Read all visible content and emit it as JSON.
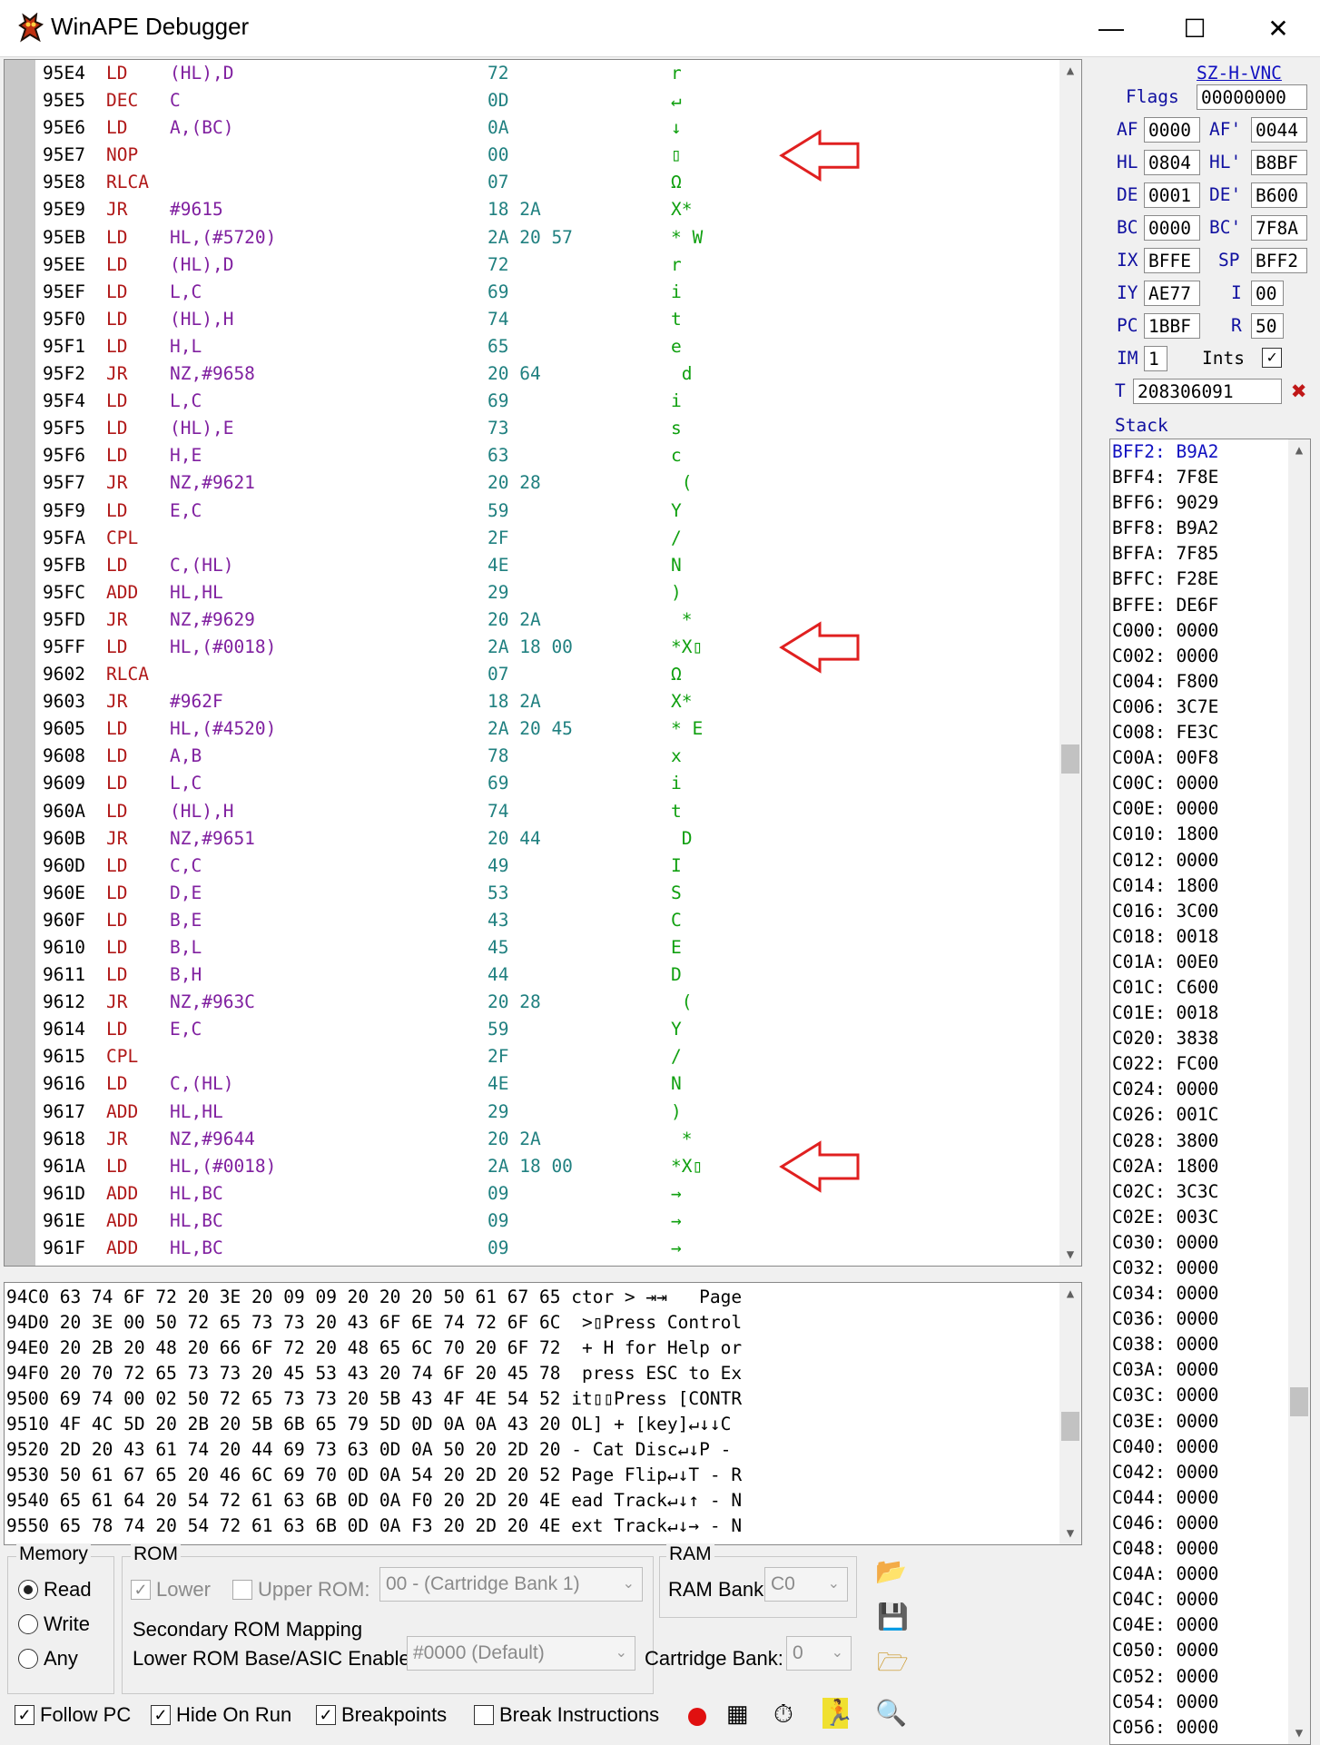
{
  "window": {
    "title": "WinAPE Debugger",
    "minimize": "—",
    "maximize": "☐",
    "close": "✕"
  },
  "disassembly": [
    {
      "addr": "95E4",
      "op": "LD",
      "arg": "(HL),D",
      "hex": "72",
      "chr": "r"
    },
    {
      "addr": "95E5",
      "op": "DEC",
      "arg": "C",
      "hex": "0D",
      "chr": "↵"
    },
    {
      "addr": "95E6",
      "op": "LD",
      "arg": "A,(BC)",
      "hex": "0A",
      "chr": "↓"
    },
    {
      "addr": "95E7",
      "op": "NOP",
      "arg": "",
      "hex": "00",
      "chr": "▯"
    },
    {
      "addr": "95E8",
      "op": "RLCA",
      "arg": "",
      "hex": "07",
      "chr": "Ω"
    },
    {
      "addr": "95E9",
      "op": "JR",
      "arg": "#9615",
      "hex": "18 2A",
      "chr": "X*"
    },
    {
      "addr": "95EB",
      "op": "LD",
      "arg": "HL,(#5720)",
      "hex": "2A 20 57",
      "chr": "* W"
    },
    {
      "addr": "95EE",
      "op": "LD",
      "arg": "(HL),D",
      "hex": "72",
      "chr": "r"
    },
    {
      "addr": "95EF",
      "op": "LD",
      "arg": "L,C",
      "hex": "69",
      "chr": "i"
    },
    {
      "addr": "95F0",
      "op": "LD",
      "arg": "(HL),H",
      "hex": "74",
      "chr": "t"
    },
    {
      "addr": "95F1",
      "op": "LD",
      "arg": "H,L",
      "hex": "65",
      "chr": "e"
    },
    {
      "addr": "95F2",
      "op": "JR",
      "arg": "NZ,#9658",
      "hex": "20 64",
      "chr": " d"
    },
    {
      "addr": "95F4",
      "op": "LD",
      "arg": "L,C",
      "hex": "69",
      "chr": "i"
    },
    {
      "addr": "95F5",
      "op": "LD",
      "arg": "(HL),E",
      "hex": "73",
      "chr": "s"
    },
    {
      "addr": "95F6",
      "op": "LD",
      "arg": "H,E",
      "hex": "63",
      "chr": "c"
    },
    {
      "addr": "95F7",
      "op": "JR",
      "arg": "NZ,#9621",
      "hex": "20 28",
      "chr": " ("
    },
    {
      "addr": "95F9",
      "op": "LD",
      "arg": "E,C",
      "hex": "59",
      "chr": "Y"
    },
    {
      "addr": "95FA",
      "op": "CPL",
      "arg": "",
      "hex": "2F",
      "chr": "/"
    },
    {
      "addr": "95FB",
      "op": "LD",
      "arg": "C,(HL)",
      "hex": "4E",
      "chr": "N"
    },
    {
      "addr": "95FC",
      "op": "ADD",
      "arg": "HL,HL",
      "hex": "29",
      "chr": ")"
    },
    {
      "addr": "95FD",
      "op": "JR",
      "arg": "NZ,#9629",
      "hex": "20 2A",
      "chr": " *"
    },
    {
      "addr": "95FF",
      "op": "LD",
      "arg": "HL,(#0018)",
      "hex": "2A 18 00",
      "chr": "*X▯"
    },
    {
      "addr": "9602",
      "op": "RLCA",
      "arg": "",
      "hex": "07",
      "chr": "Ω"
    },
    {
      "addr": "9603",
      "op": "JR",
      "arg": "#962F",
      "hex": "18 2A",
      "chr": "X*"
    },
    {
      "addr": "9605",
      "op": "LD",
      "arg": "HL,(#4520)",
      "hex": "2A 20 45",
      "chr": "* E"
    },
    {
      "addr": "9608",
      "op": "LD",
      "arg": "A,B",
      "hex": "78",
      "chr": "x"
    },
    {
      "addr": "9609",
      "op": "LD",
      "arg": "L,C",
      "hex": "69",
      "chr": "i"
    },
    {
      "addr": "960A",
      "op": "LD",
      "arg": "(HL),H",
      "hex": "74",
      "chr": "t"
    },
    {
      "addr": "960B",
      "op": "JR",
      "arg": "NZ,#9651",
      "hex": "20 44",
      "chr": " D"
    },
    {
      "addr": "960D",
      "op": "LD",
      "arg": "C,C",
      "hex": "49",
      "chr": "I"
    },
    {
      "addr": "960E",
      "op": "LD",
      "arg": "D,E",
      "hex": "53",
      "chr": "S"
    },
    {
      "addr": "960F",
      "op": "LD",
      "arg": "B,E",
      "hex": "43",
      "chr": "C"
    },
    {
      "addr": "9610",
      "op": "LD",
      "arg": "B,L",
      "hex": "45",
      "chr": "E"
    },
    {
      "addr": "9611",
      "op": "LD",
      "arg": "B,H",
      "hex": "44",
      "chr": "D"
    },
    {
      "addr": "9612",
      "op": "JR",
      "arg": "NZ,#963C",
      "hex": "20 28",
      "chr": " ("
    },
    {
      "addr": "9614",
      "op": "LD",
      "arg": "E,C",
      "hex": "59",
      "chr": "Y"
    },
    {
      "addr": "9615",
      "op": "CPL",
      "arg": "",
      "hex": "2F",
      "chr": "/"
    },
    {
      "addr": "9616",
      "op": "LD",
      "arg": "C,(HL)",
      "hex": "4E",
      "chr": "N"
    },
    {
      "addr": "9617",
      "op": "ADD",
      "arg": "HL,HL",
      "hex": "29",
      "chr": ")"
    },
    {
      "addr": "9618",
      "op": "JR",
      "arg": "NZ,#9644",
      "hex": "20 2A",
      "chr": " *"
    },
    {
      "addr": "961A",
      "op": "LD",
      "arg": "HL,(#0018)",
      "hex": "2A 18 00",
      "chr": "*X▯"
    },
    {
      "addr": "961D",
      "op": "ADD",
      "arg": "HL,BC",
      "hex": "09",
      "chr": "→"
    },
    {
      "addr": "961E",
      "op": "ADD",
      "arg": "HL,BC",
      "hex": "09",
      "chr": "→"
    },
    {
      "addr": "961F",
      "op": "ADD",
      "arg": "HL,BC",
      "hex": "09",
      "chr": "→"
    }
  ],
  "memory": [
    "94C0 63 74 6F 72 20 3E 20 09 09 20 20 20 50 61 67 65 ctor > ⇥⇥   Page",
    "94D0 20 3E 00 50 72 65 73 73 20 43 6F 6E 74 72 6F 6C  >▯Press Control",
    "94E0 20 2B 20 48 20 66 6F 72 20 48 65 6C 70 20 6F 72  + H for Help or",
    "94F0 20 70 72 65 73 73 20 45 53 43 20 74 6F 20 45 78  press ESC to Ex",
    "9500 69 74 00 02 50 72 65 73 73 20 5B 43 4F 4E 54 52 it▯▯Press [CONTR",
    "9510 4F 4C 5D 20 2B 20 5B 6B 65 79 5D 0D 0A 0A 43 20 OL] + [key]↵↓↓C ",
    "9520 2D 20 43 61 74 20 44 69 73 63 0D 0A 50 20 2D 20 - Cat Disc↵↓P - ",
    "9530 50 61 67 65 20 46 6C 69 70 0D 0A 54 20 2D 20 52 Page Flip↵↓T - R",
    "9540 65 61 64 20 54 72 61 63 6B 0D 0A F0 20 2D 20 4E ead Track↵↓↑ - N",
    "9550 65 78 74 20 54 72 61 63 6B 0D 0A F3 20 2D 20 4E ext Track↵↓→ - N"
  ],
  "registers": {
    "flags_name": "SZ-H-VNC",
    "flags_label": "Flags",
    "flags": "00000000",
    "AF": "0000",
    "AF_alt": "0044",
    "HL": "0804",
    "HL_alt": "B8BF",
    "DE": "0001",
    "DE_alt": "B600",
    "BC": "0000",
    "BC_alt": "7F8A",
    "IX": "BFFE",
    "SP": "BFF2",
    "IY": "AE77",
    "I": "00",
    "PC": "1BBF",
    "R": "50",
    "IM": "1",
    "ints_label": "Ints",
    "T": "208306091"
  },
  "reg_labels": {
    "AF": "AF",
    "AF_alt": "AF'",
    "HL": "HL",
    "HL_alt": "HL'",
    "DE": "DE",
    "DE_alt": "DE'",
    "BC": "BC",
    "BC_alt": "BC'",
    "IX": "IX",
    "SP": "SP",
    "IY": "IY",
    "I": "I",
    "PC": "PC",
    "R": "R",
    "IM": "IM",
    "T": "T"
  },
  "stack_label": "Stack",
  "stack": [
    "BFF2: B9A2",
    "BFF4: 7F8E",
    "BFF6: 9029",
    "BFF8: B9A2",
    "BFFA: 7F85",
    "BFFC: F28E",
    "BFFE: DE6F",
    "C000: 0000",
    "C002: 0000",
    "C004: F800",
    "C006: 3C7E",
    "C008: FE3C",
    "C00A: 00F8",
    "C00C: 0000",
    "C00E: 0000",
    "C010: 1800",
    "C012: 0000",
    "C014: 1800",
    "C016: 3C00",
    "C018: 0018",
    "C01A: 00E0",
    "C01C: C600",
    "C01E: 0018",
    "C020: 3838",
    "C022: FC00",
    "C024: 0000",
    "C026: 001C",
    "C028: 3800",
    "C02A: 1800",
    "C02C: 3C3C",
    "C02E: 003C",
    "C030: 0000",
    "C032: 0000",
    "C034: 0000",
    "C036: 0000",
    "C038: 0000",
    "C03A: 0000",
    "C03C: 0000",
    "C03E: 0000",
    "C040: 0000",
    "C042: 0000",
    "C044: 0000",
    "C046: 0000",
    "C048: 0000",
    "C04A: 0000",
    "C04C: 0000",
    "C04E: 0000",
    "C050: 0000",
    "C052: 0000",
    "C054: 0000",
    "C056: 0000"
  ],
  "controls": {
    "memory_group": "Memory",
    "read": "Read",
    "write": "Write",
    "any": "Any",
    "rom_group": "ROM",
    "lower": "Lower",
    "upper_rom": "Upper ROM:",
    "upper_rom_value": "00 - (Cartridge Bank 1)",
    "ram_group": "RAM",
    "ram_bank": "RAM Bank:",
    "ram_bank_value": "C0",
    "secondary_group": "Secondary ROM Mapping",
    "lower_rom_base": "Lower ROM Base/ASIC Enable:",
    "lower_rom_base_value": "#0000 (Default)",
    "cartridge_bank": "Cartridge Bank:",
    "cartridge_bank_value": "0",
    "follow_pc": "Follow PC",
    "hide_on_run": "Hide On Run",
    "breakpoints": "Breakpoints",
    "break_instructions": "Break Instructions"
  },
  "annotations": {
    "arrow_color": "#e02020",
    "arrow_rows": [
      3,
      21,
      40
    ]
  }
}
